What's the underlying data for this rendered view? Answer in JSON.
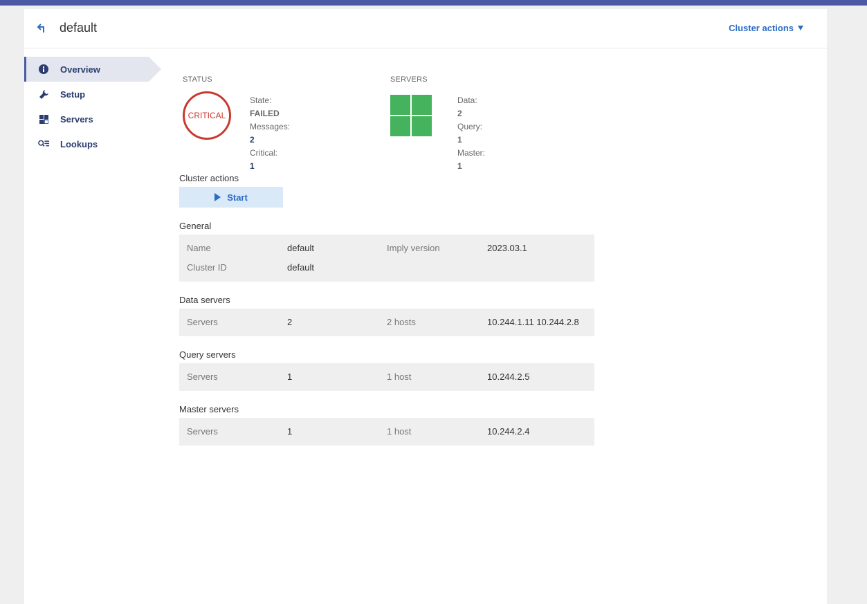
{
  "header": {
    "title": "default",
    "cluster_actions_label": "Cluster actions"
  },
  "sidebar": {
    "items": [
      {
        "label": "Overview",
        "icon": "info-icon",
        "active": true
      },
      {
        "label": "Setup",
        "icon": "wrench-icon",
        "active": false
      },
      {
        "label": "Servers",
        "icon": "grid-icon",
        "active": false
      },
      {
        "label": "Lookups",
        "icon": "lookup-icon",
        "active": false
      }
    ]
  },
  "status": {
    "label": "STATUS",
    "badge": "CRITICAL",
    "state_label": "State:",
    "state_value": "FAILED",
    "messages_label": "Messages:",
    "messages_value": "2",
    "critical_label": "Critical:",
    "critical_value": "1"
  },
  "servers_summary": {
    "label": "SERVERS",
    "data_label": "Data:",
    "data_value": "2",
    "query_label": "Query:",
    "query_value": "1",
    "master_label": "Master:",
    "master_value": "1"
  },
  "cluster_actions": {
    "title": "Cluster actions",
    "start_label": "Start"
  },
  "general": {
    "title": "General",
    "name_label": "Name",
    "name_value": "default",
    "version_label": "Imply version",
    "version_value": "2023.03.1",
    "cluster_id_label": "Cluster ID",
    "cluster_id_value": "default"
  },
  "data_servers": {
    "title": "Data servers",
    "servers_label": "Servers",
    "count": "2",
    "hosts": "2 hosts",
    "addresses": "10.244.1.11 10.244.2.8"
  },
  "query_servers": {
    "title": "Query servers",
    "servers_label": "Servers",
    "count": "1",
    "hosts": "1 host",
    "addresses": "10.244.2.5"
  },
  "master_servers": {
    "title": "Master servers",
    "servers_label": "Servers",
    "count": "1",
    "hosts": "1 host",
    "addresses": "10.244.2.4"
  },
  "colors": {
    "accent": "#4b5aa3",
    "link": "#2c6cc4",
    "critical": "#c83a2e",
    "healthy": "#45b25e"
  }
}
